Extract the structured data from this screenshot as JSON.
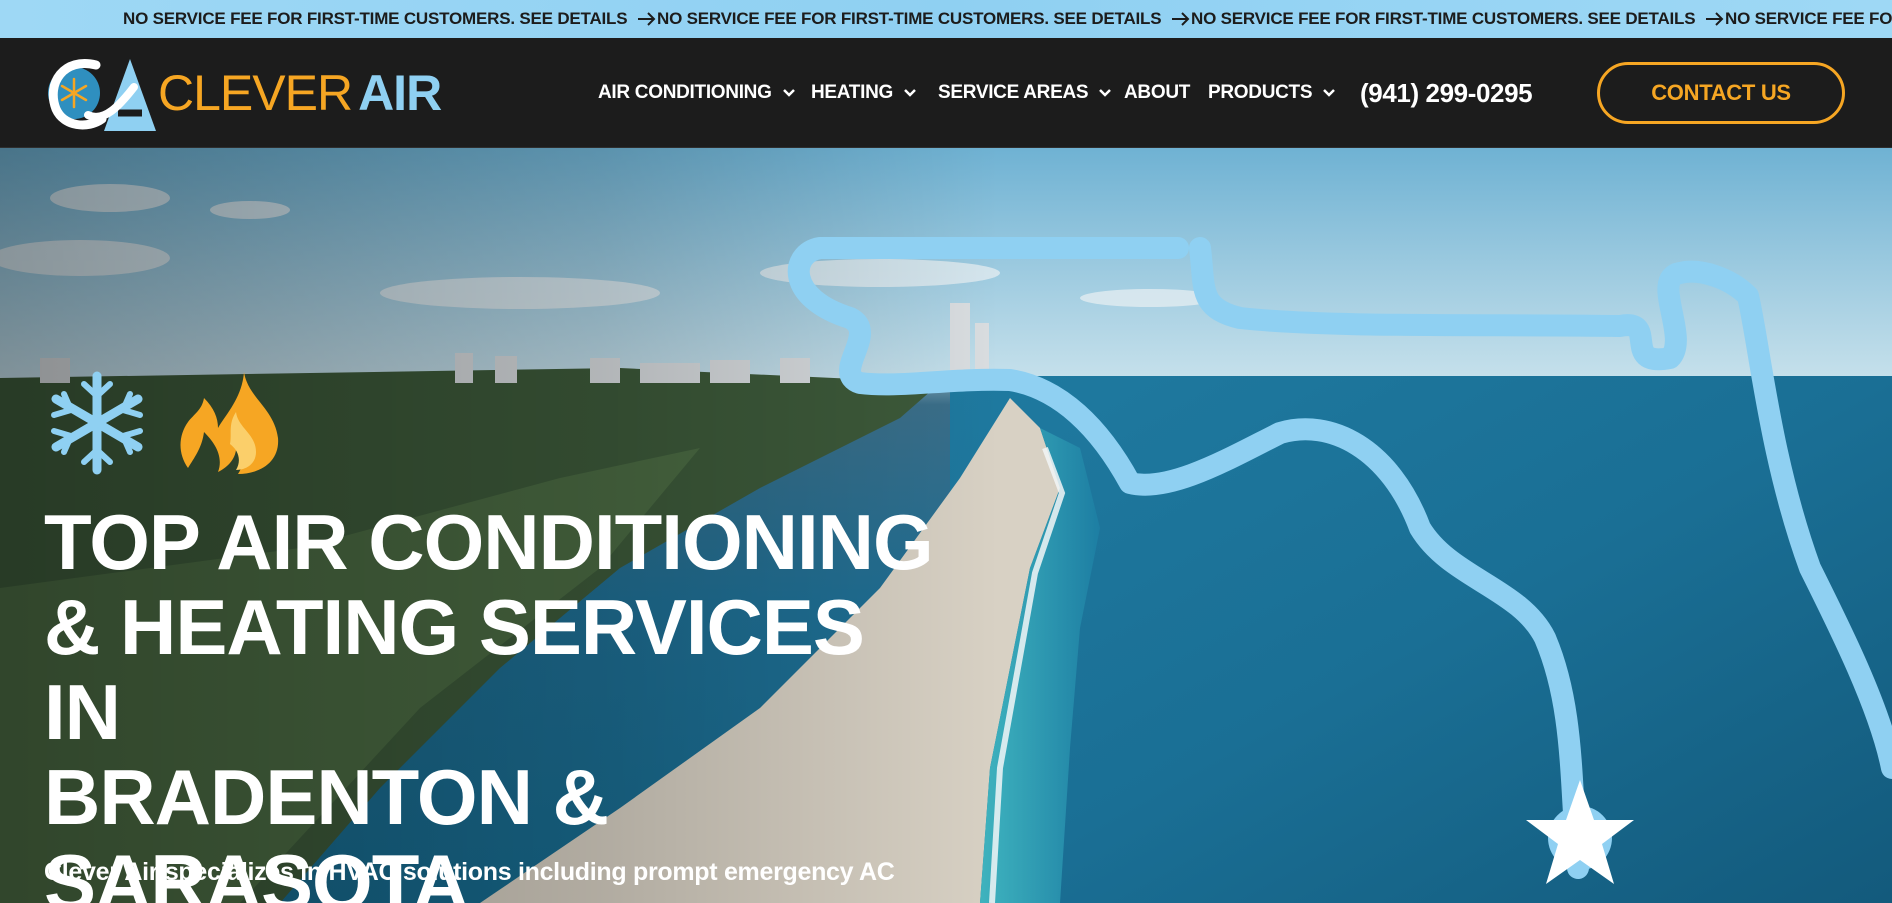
{
  "ticker": {
    "message": "NO SERVICE FEE FOR FIRST-TIME CUSTOMERS. SEE DETAILS",
    "arrow_icon": "arrow-right-icon"
  },
  "brand": {
    "name_part1": "CLEVER",
    "name_part2": "AIR",
    "color_orange": "#f6a623",
    "color_blue": "#8fd0f2",
    "color_dark": "#1c1c1c"
  },
  "nav": {
    "items": [
      {
        "label": "AIR CONDITIONING",
        "has_dropdown": true
      },
      {
        "label": "HEATING",
        "has_dropdown": true
      },
      {
        "label": "SERVICE AREAS",
        "has_dropdown": true
      },
      {
        "label": "ABOUT",
        "has_dropdown": false
      },
      {
        "label": "PRODUCTS",
        "has_dropdown": true
      }
    ],
    "phone": "(941) 299-0295",
    "contact_label": "CONTACT US"
  },
  "hero": {
    "icons": [
      "snowflake-icon",
      "flame-icon"
    ],
    "title_lines": [
      "TOP AIR CONDITIONING",
      "& HEATING SERVICES IN",
      "BRADENTON &",
      "SARASOTA"
    ],
    "subtitle": "Clever Air specializes in HVAC solutions including prompt emergency AC"
  }
}
